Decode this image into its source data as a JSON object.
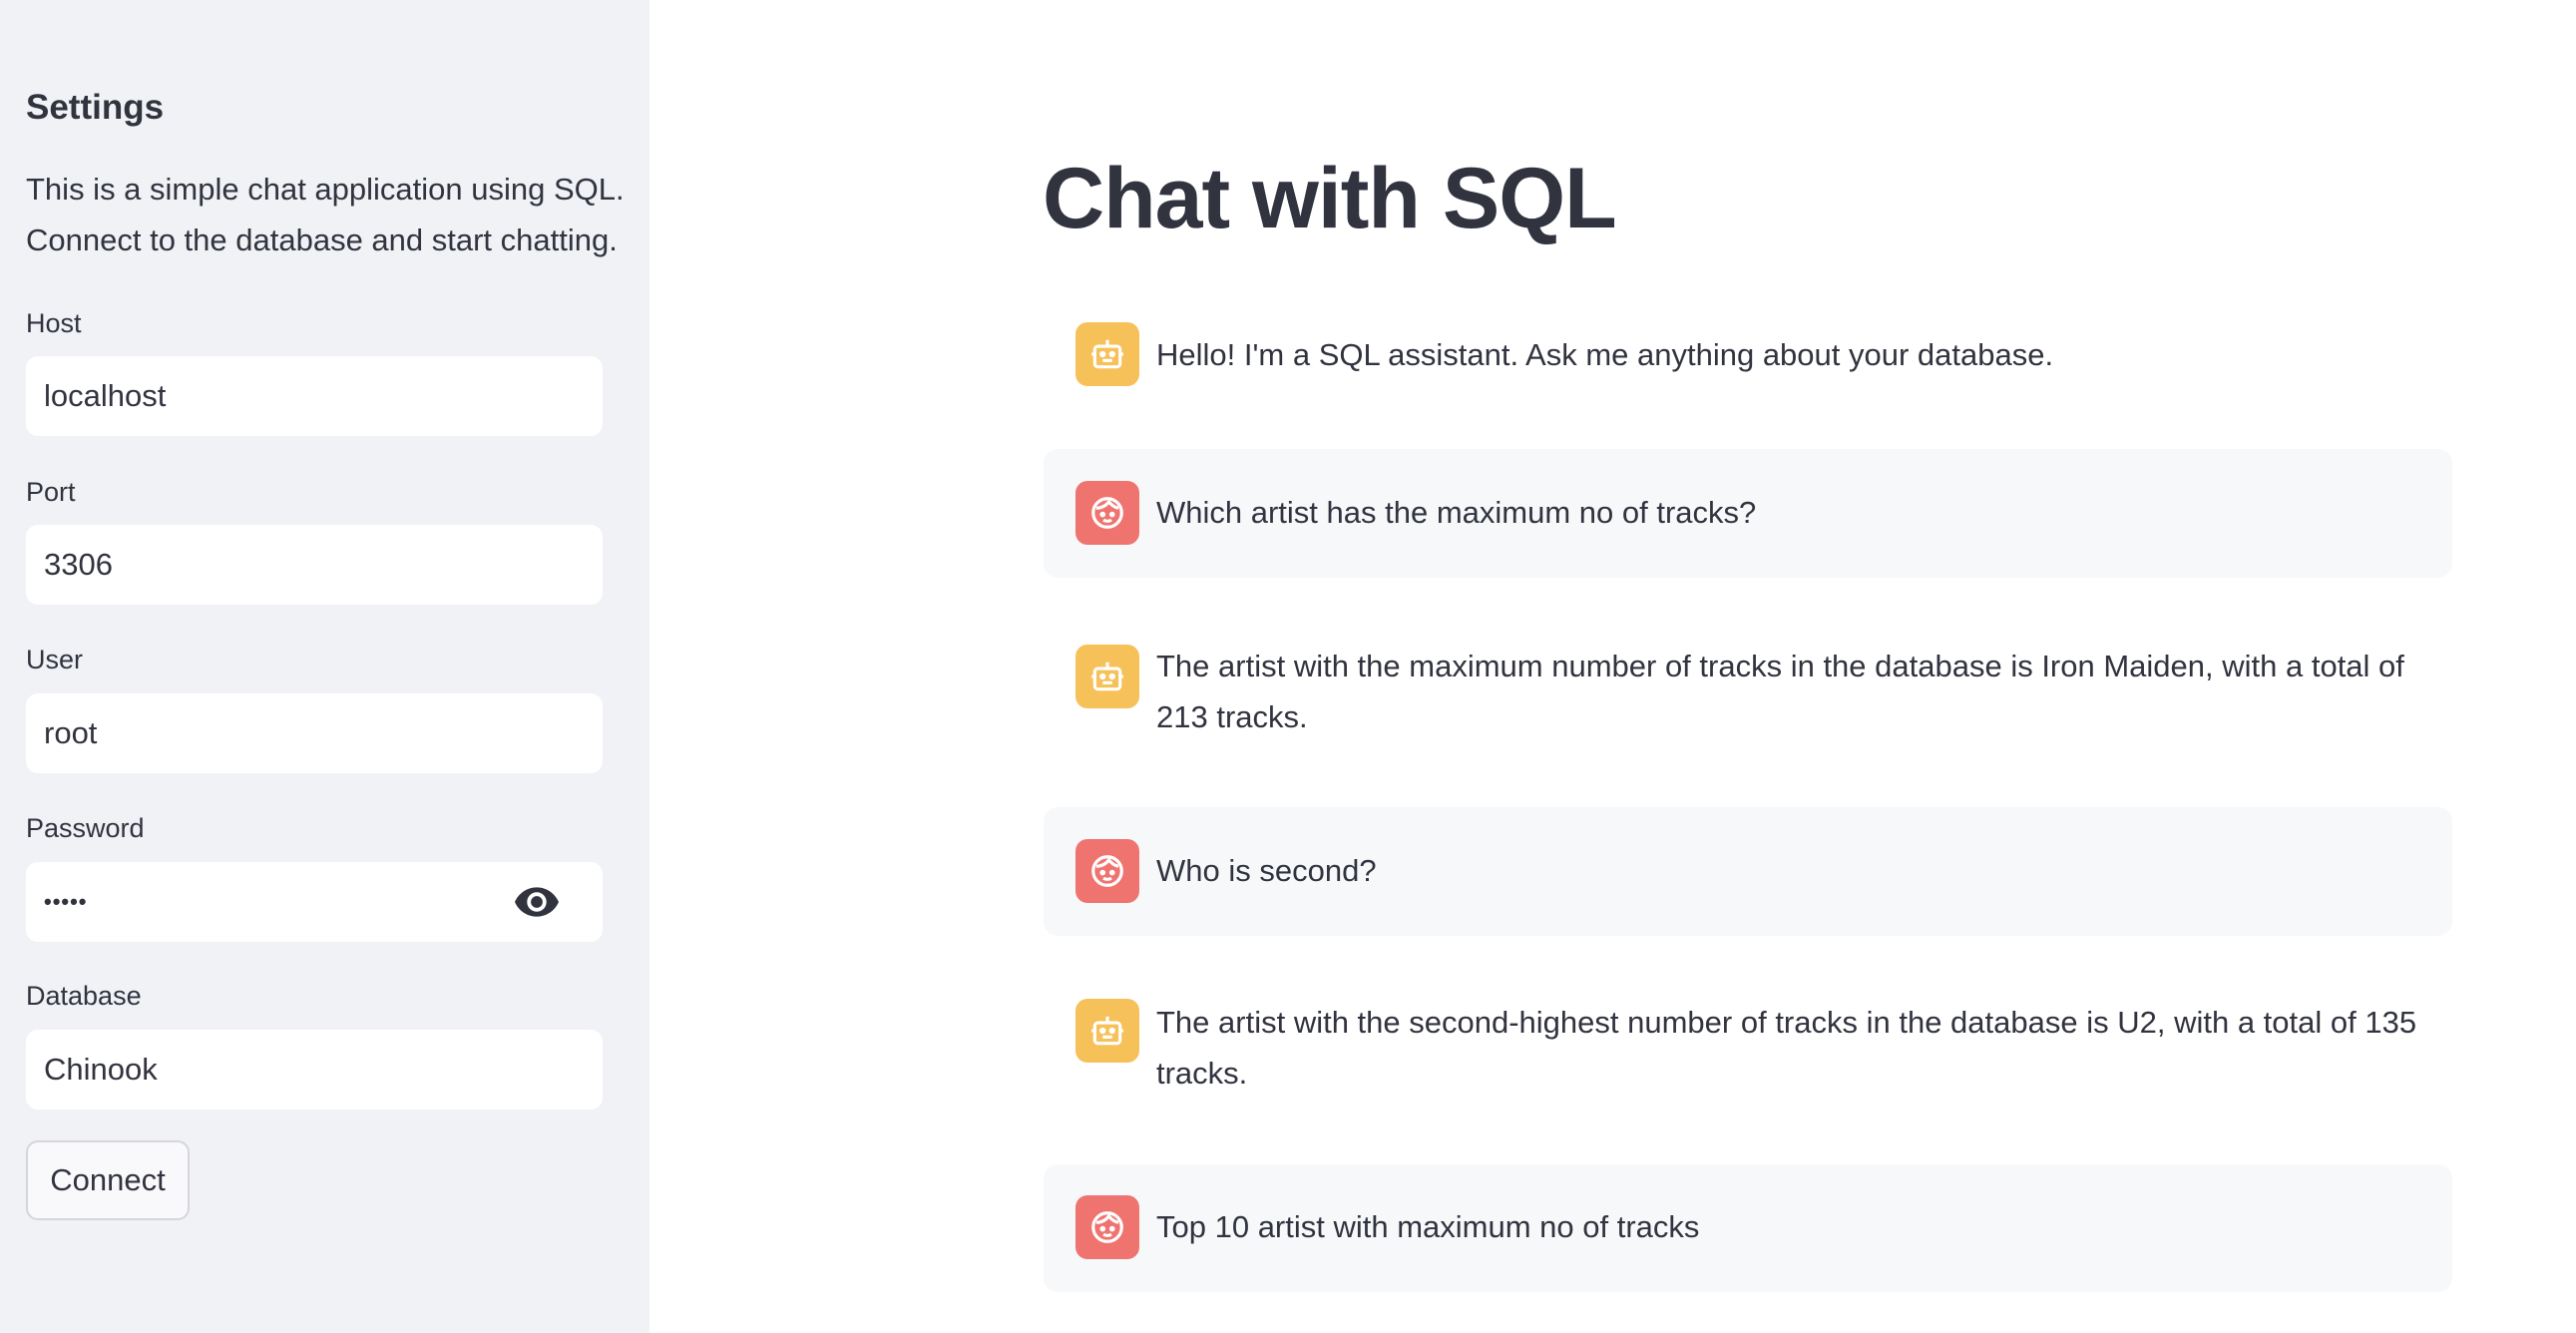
{
  "sidebar": {
    "title": "Settings",
    "description": "This is a simple chat application using SQL. Connect to the database and start chatting.",
    "fields": [
      {
        "label": "Host",
        "value": "localhost"
      },
      {
        "label": "Port",
        "value": "3306"
      },
      {
        "label": "User",
        "value": "root"
      },
      {
        "label": "Password",
        "value": "•••••"
      },
      {
        "label": "Database",
        "value": "Chinook"
      }
    ],
    "connect_label": "Connect",
    "password_toggle_icon": "eye-icon"
  },
  "main": {
    "title": "Chat with SQL",
    "messages": [
      {
        "role": "assistant",
        "icon": "robot-icon",
        "text": "Hello! I'm a SQL assistant. Ask me anything about your database."
      },
      {
        "role": "user",
        "icon": "face-icon",
        "text": "Which artist has the maximum no of tracks?"
      },
      {
        "role": "assistant",
        "icon": "robot-icon",
        "text": "The artist with the maximum number of tracks in the database is Iron Maiden, with a total of 213 tracks."
      },
      {
        "role": "user",
        "icon": "face-icon",
        "text": "Who is second?"
      },
      {
        "role": "assistant",
        "icon": "robot-icon",
        "text": "The artist with the second-highest number of tracks in the database is U2, with a total of 135 tracks."
      },
      {
        "role": "user",
        "icon": "face-icon",
        "text": "Top 10 artist with maximum no of tracks"
      }
    ]
  },
  "colors": {
    "sidebar_bg": "#f0f2f6",
    "assistant_avatar": "#f7c15a",
    "user_avatar": "#ef7470",
    "user_message_bg": "#f7f8fa",
    "text": "#31333f"
  }
}
